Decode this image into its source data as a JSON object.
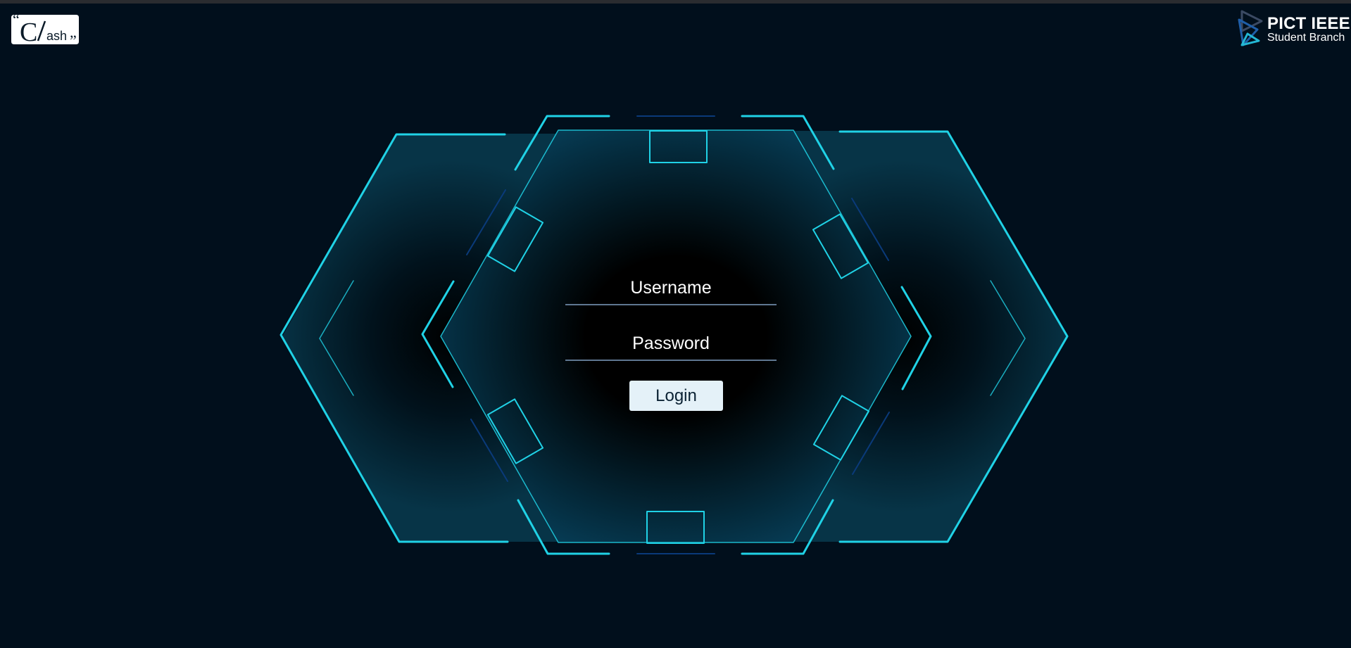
{
  "header": {
    "left_logo": {
      "icon": "clash-logo",
      "text_big": "C",
      "text_small": "ash"
    },
    "right_logo": {
      "icon": "pict-ieee-logo",
      "name": "PICT IEEE",
      "subtitle": "Student Branch"
    }
  },
  "login": {
    "username": {
      "placeholder": "Username",
      "value": ""
    },
    "password": {
      "placeholder": "Password",
      "value": ""
    },
    "submit_label": "Login"
  },
  "theme": {
    "background": "#010f1c",
    "accent": "#20d2e6",
    "button_bg": "#e4f1f8"
  }
}
